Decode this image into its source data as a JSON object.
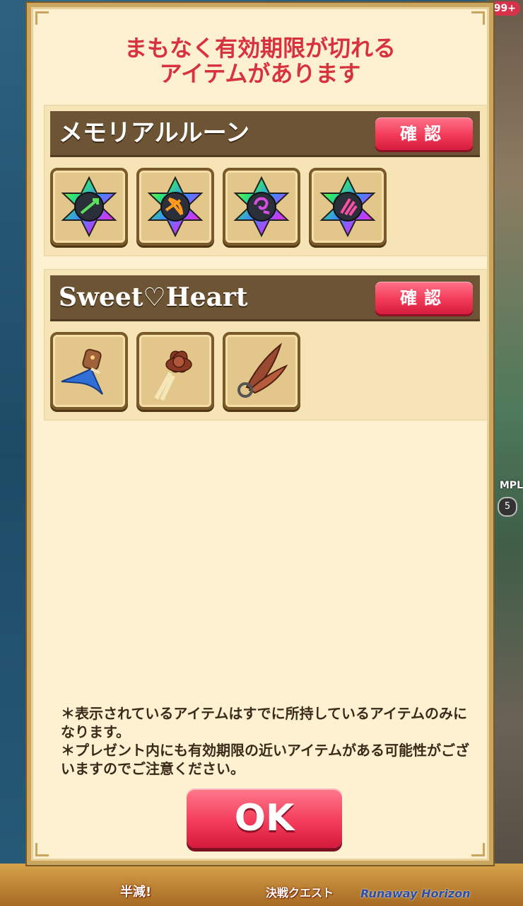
{
  "background": {
    "notification_badge": "99+",
    "complete_tag": "MPL",
    "complete_count": "5",
    "bottom_labels": [
      "半減!",
      "決戦クエスト",
      "Runaway Horizon"
    ]
  },
  "dialog": {
    "title_line1": "まもなく有効期限が切れる",
    "title_line2": "アイテムがあります",
    "sections": [
      {
        "title": "メモリアルルーン",
        "confirm_label": "確認",
        "items": [
          "rune-arrow-icon",
          "rune-bow-icon",
          "rune-swirl-icon",
          "rune-claw-icon"
        ]
      },
      {
        "title": "Sweet♡Heart",
        "confirm_label": "確認",
        "items": [
          "ribbon-bell-icon",
          "rose-ribbon-icon",
          "feather-wing-icon"
        ]
      }
    ],
    "note_line1": "＊表示されているアイテムはすでに所持しているアイテムのみになります。",
    "note_line2": "＊プレゼント内にも有効期限の近いアイテムがある可能性がございますのでご注意ください。",
    "ok_label": "OK"
  },
  "colors": {
    "title_red": "#d8323f",
    "button_red": "#f23a58",
    "header_brown": "#6d5434",
    "panel_cream": "#fdf1d1"
  }
}
